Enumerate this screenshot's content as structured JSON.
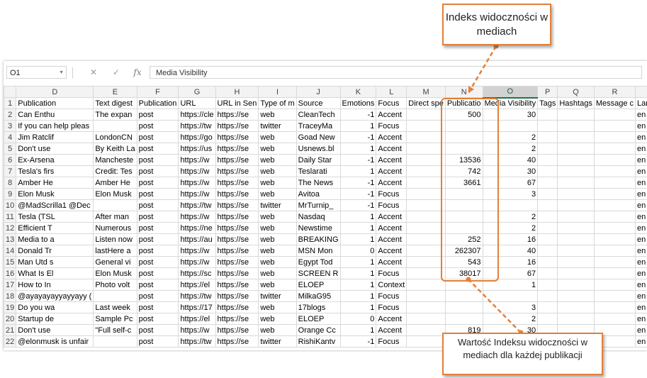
{
  "formula_bar": {
    "cell_ref": "O1",
    "cancel_icon": "x-mark-icon",
    "enter_icon": "check-mark-icon",
    "fx_label": "fx",
    "content": "Media Visibility"
  },
  "columns": [
    "D",
    "E",
    "F",
    "G",
    "H",
    "I",
    "J",
    "K",
    "L",
    "M",
    "N",
    "O",
    "P",
    "Q",
    "R",
    "S"
  ],
  "selected_column": "O",
  "rows": [
    {
      "n": "1",
      "cells": [
        "Publication",
        "Text digest",
        "Publication",
        "URL",
        "URL in Sen",
        "Type of m",
        "Source",
        "Emotions",
        "Focus",
        "Direct spe",
        "Publicatio",
        "Media Visibility",
        "Tags",
        "Hashtags",
        "Message c",
        "Language"
      ]
    },
    {
      "n": "2",
      "cells": [
        "Can Enthu",
        "The expan",
        "post",
        "https://cle",
        "https://se",
        "web",
        "CleanTech",
        "-1",
        "Accent",
        "",
        "500",
        "30",
        "",
        "",
        "",
        "en"
      ]
    },
    {
      "n": "3",
      "cells": [
        "If you can help pleas",
        "",
        "post",
        "https://tw",
        "https://se",
        "twitter",
        "TraceyMa",
        "1",
        "Focus",
        "",
        "",
        "",
        "",
        "",
        "",
        "en"
      ]
    },
    {
      "n": "4",
      "cells": [
        "Jim Ratclif",
        "LondonCN",
        "post",
        "https://go",
        "https://se",
        "web",
        "Goad New",
        "-1",
        "Accent",
        "",
        "",
        "2",
        "",
        "",
        "",
        "en"
      ]
    },
    {
      "n": "5",
      "cells": [
        "Don't use",
        "By Keith La",
        "post",
        "https://us",
        "https://se",
        "web",
        "Usnews.bl",
        "1",
        "Accent",
        "",
        "",
        "2",
        "",
        "",
        "",
        "en"
      ]
    },
    {
      "n": "6",
      "cells": [
        "Ex-Arsena",
        "Mancheste",
        "post",
        "https://w",
        "https://se",
        "web",
        "Daily Star",
        "-1",
        "Accent",
        "",
        "13536",
        "40",
        "",
        "",
        "",
        "en"
      ]
    },
    {
      "n": "7",
      "cells": [
        "Tesla's firs",
        "Credit: Tes",
        "post",
        "https://w",
        "https://se",
        "web",
        "Teslarati",
        "1",
        "Accent",
        "",
        "742",
        "30",
        "",
        "",
        "",
        "en"
      ]
    },
    {
      "n": "8",
      "cells": [
        "Amber He",
        "Amber He",
        "post",
        "https://w",
        "https://se",
        "web",
        "The News",
        "-1",
        "Accent",
        "",
        "3661",
        "67",
        "",
        "",
        "",
        "en"
      ]
    },
    {
      "n": "9",
      "cells": [
        "Elon Musk",
        "Elon Musk",
        "post",
        "https://w",
        "https://se",
        "web",
        "Avitoa",
        "-1",
        "Focus",
        "",
        "",
        "3",
        "",
        "",
        "",
        "en"
      ]
    },
    {
      "n": "10",
      "cells": [
        "@MadScrilla1 @Dec",
        "",
        "post",
        "https://tw",
        "https://se",
        "twitter",
        "MrTurnip_",
        "-1",
        "Focus",
        "",
        "",
        "",
        "",
        "",
        "",
        "en"
      ]
    },
    {
      "n": "11",
      "cells": [
        "Tesla (TSL",
        "After man",
        "post",
        "https://w",
        "https://se",
        "web",
        "Nasdaq",
        "1",
        "Accent",
        "",
        "",
        "2",
        "",
        "",
        "",
        "en"
      ]
    },
    {
      "n": "12",
      "cells": [
        "Efficient T",
        "Numerous",
        "post",
        "https://ne",
        "https://se",
        "web",
        "Newstime",
        "1",
        "Accent",
        "",
        "",
        "2",
        "",
        "",
        "",
        "en"
      ]
    },
    {
      "n": "13",
      "cells": [
        "Media to a",
        "Listen now",
        "post",
        "https://au",
        "https://se",
        "web",
        "BREAKING",
        "1",
        "Accent",
        "",
        "252",
        "16",
        "",
        "",
        "",
        "en"
      ]
    },
    {
      "n": "14",
      "cells": [
        "Donald Tr",
        "lastHere a",
        "post",
        "https://w",
        "https://se",
        "web",
        "MSN Mon",
        "0",
        "Accent",
        "",
        "262307",
        "40",
        "",
        "",
        "",
        "en"
      ]
    },
    {
      "n": "15",
      "cells": [
        "Man Utd s",
        "General vi",
        "post",
        "https://w",
        "https://se",
        "web",
        "Egypt Tod",
        "1",
        "Accent",
        "",
        "543",
        "16",
        "",
        "",
        "",
        "en"
      ]
    },
    {
      "n": "16",
      "cells": [
        "What Is El",
        "Elon Musk",
        "post",
        "https://sc",
        "https://se",
        "web",
        "SCREEN R",
        "1",
        "Focus",
        "",
        "38017",
        "67",
        "",
        "",
        "",
        "en"
      ]
    },
    {
      "n": "17",
      "cells": [
        "How to In",
        "Photo volt",
        "post",
        "https://el",
        "https://se",
        "web",
        "ELOEP",
        "1",
        "Context",
        "",
        "",
        "1",
        "",
        "",
        "",
        "en"
      ]
    },
    {
      "n": "18",
      "cells": [
        "@ayayayayyayyayy (",
        "",
        "post",
        "https://tw",
        "https://se",
        "twitter",
        "MilkaG95",
        "1",
        "Focus",
        "",
        "",
        "",
        "",
        "",
        "",
        "en"
      ]
    },
    {
      "n": "19",
      "cells": [
        "Do you wa",
        "Last week",
        "post",
        "https://17",
        "https://se",
        "web",
        "17blogs",
        "1",
        "Focus",
        "",
        "",
        "3",
        "",
        "",
        "",
        "en"
      ]
    },
    {
      "n": "20",
      "cells": [
        "Startup de",
        "Sample Pc",
        "post",
        "https://el",
        "https://se",
        "web",
        "ELOEP",
        "0",
        "Accent",
        "",
        "",
        "2",
        "",
        "",
        "",
        "en"
      ]
    },
    {
      "n": "21",
      "cells": [
        "Don't use",
        "\"Full self-c",
        "post",
        "https://w",
        "https://se",
        "web",
        "Orange Cc",
        "1",
        "Accent",
        "",
        "819",
        "30",
        "",
        "",
        "",
        "en"
      ]
    },
    {
      "n": "22",
      "cells": [
        "@elonmusk is unfair",
        "",
        "post",
        "https://tw",
        "https://se",
        "twitter",
        "RishiKantv",
        "-1",
        "Focus",
        "",
        "",
        "",
        "",
        "",
        "",
        "en"
      ]
    }
  ],
  "callouts": {
    "top": "Indeks widoczności w mediach",
    "bottom": "Wartość Indeksu widoczności w mediach dla każdej publikacji"
  },
  "colors": {
    "accent": "#e1803a",
    "excel_green": "#217346"
  }
}
